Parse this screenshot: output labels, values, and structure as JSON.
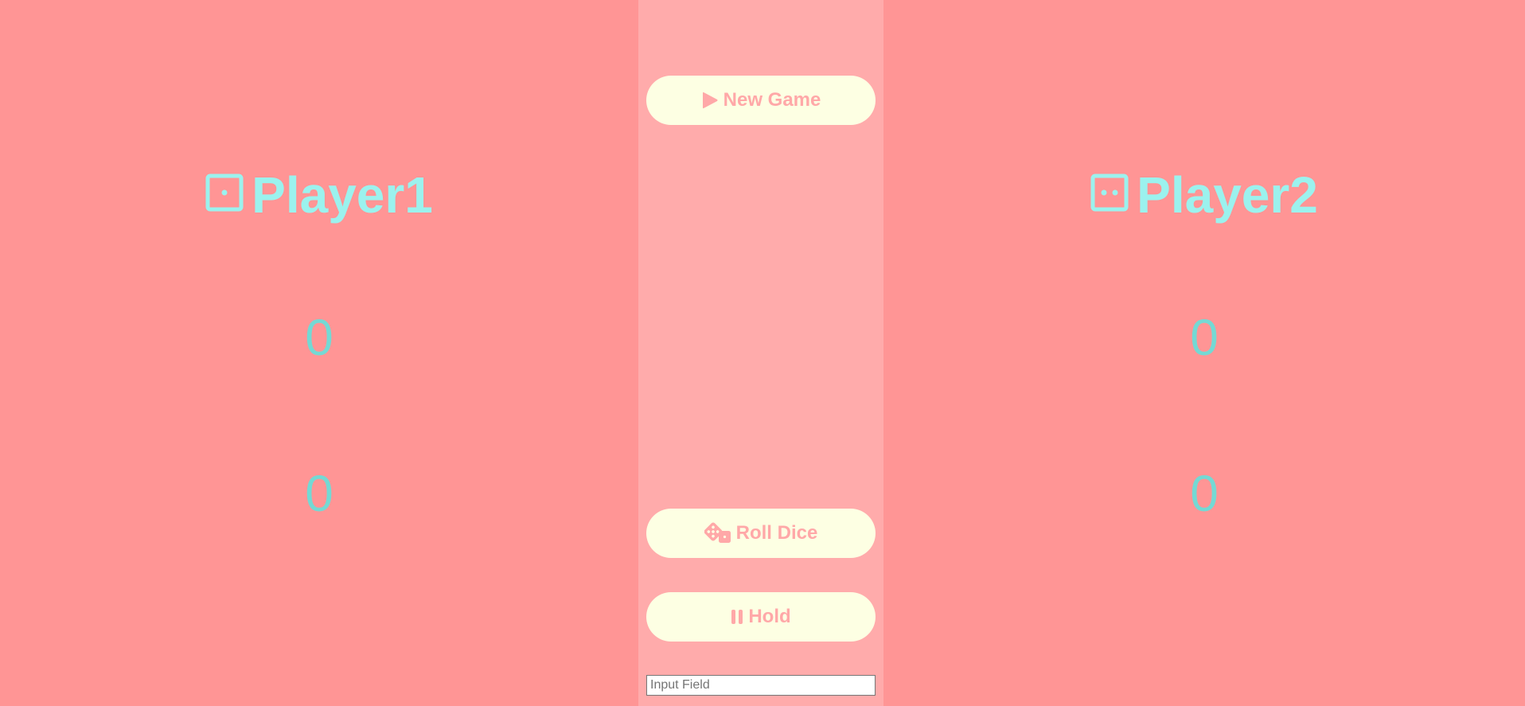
{
  "players": [
    {
      "name": "Player1",
      "icon": "dice-one-icon",
      "total_score": "0",
      "current_score": "0"
    },
    {
      "name": "Player2",
      "icon": "dice-two-icon",
      "total_score": "0",
      "current_score": "0"
    }
  ],
  "controls": {
    "new_game": {
      "label": "New Game",
      "icon": "play-icon"
    },
    "roll_dice": {
      "label": "Roll Dice",
      "icon": "dice-icon"
    },
    "hold": {
      "label": "Hold",
      "icon": "pause-icon"
    }
  },
  "input": {
    "placeholder": "Input Field",
    "value": ""
  },
  "colors": {
    "player_panel": "#ff9595",
    "center_panel": "#ffabab",
    "player_name": "#9bf2ee",
    "score": "#74d9d4",
    "button_bg": "#fdffe3",
    "button_text": "#ffa8a8"
  }
}
